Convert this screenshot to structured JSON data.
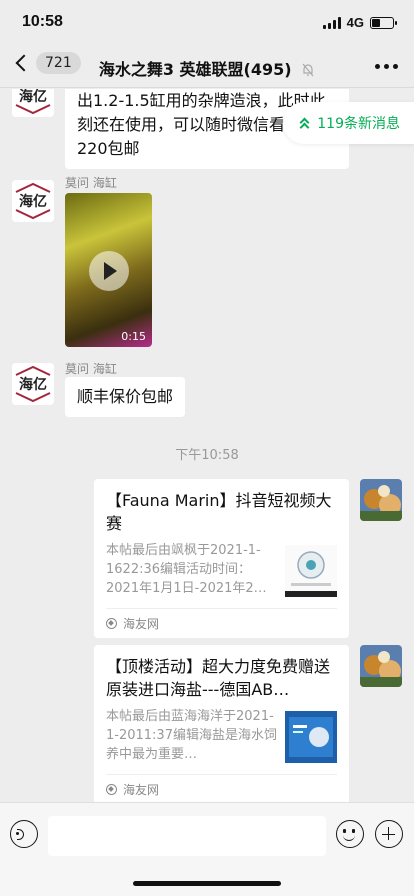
{
  "status_bar": {
    "time": "10:58",
    "network": "4G"
  },
  "header": {
    "back_count": "721",
    "title": "海水之舞3 英雄联盟(495)"
  },
  "new_messages": {
    "label": "119条新消息"
  },
  "messages": [
    {
      "text": "出1.2-1.5缸用的杂牌造浪，此时此刻还在使用，可以随时微信看视频，220包邮"
    },
    {
      "sender": "莫问 海缸",
      "video_duration": "0:15"
    },
    {
      "sender": "莫问 海缸",
      "text": "顺丰保价包邮"
    }
  ],
  "timestamp": "下午10:58",
  "link_cards": [
    {
      "title": "【Fauna Marin】抖音短视频大赛",
      "desc": "本帖最后由飒枫于2021-1-1622:36编辑活动时间：2021年1月1日-2021年2…",
      "source": "海友网"
    },
    {
      "title": "【顶楼活动】超大力度免费赠送原装进口海盐---德国AB…",
      "desc": "本帖最后由蓝海海洋于2021-1-2011:37编辑海盐是海水饲养中最为重要…",
      "source": "海友网"
    }
  ],
  "input": {
    "placeholder": ""
  },
  "colors": {
    "accent_green": "#06ae56",
    "chat_bg": "#ededed"
  }
}
